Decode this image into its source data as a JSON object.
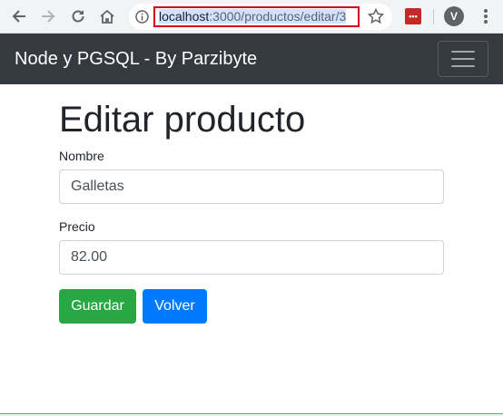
{
  "browser": {
    "url_host": "localhost",
    "url_path": ":3000/productos/editar/3",
    "icons": {
      "back": "arrow-left-icon",
      "forward": "arrow-right-icon",
      "reload": "reload-icon",
      "home": "home-icon",
      "info": "info-icon",
      "bookmark": "star-icon",
      "extension": "extension-icon",
      "profile": "profile-icon",
      "menu": "kebab-menu-icon"
    },
    "extension_glyph": "•••",
    "profile_glyph": "V"
  },
  "navbar": {
    "brand": "Node y PGSQL - By Parzibyte",
    "background": "#343a40"
  },
  "form": {
    "title": "Editar producto",
    "fields": [
      {
        "label": "Nombre",
        "value": "Galletas"
      },
      {
        "label": "Precio",
        "value": "82.00"
      }
    ],
    "buttons": {
      "save": "Guardar",
      "back": "Volver"
    }
  },
  "colors": {
    "success": "#28a745",
    "primary": "#007bff",
    "highlight_border": "#d0021b"
  }
}
